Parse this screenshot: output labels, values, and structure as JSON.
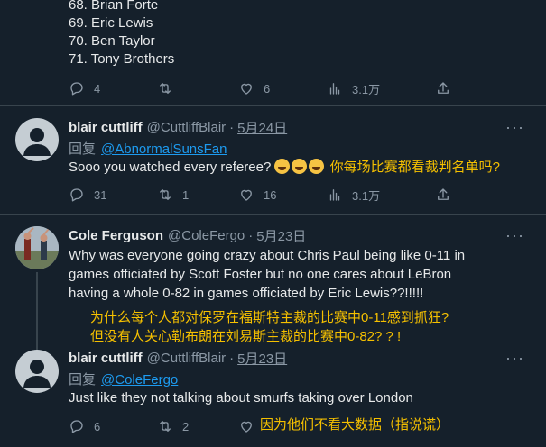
{
  "top_list": {
    "items": [
      "68. Brian Forte",
      "69. Eric Lewis",
      "70. Ben Taylor",
      "71. Tony Brothers"
    ],
    "actions": {
      "replies": "4",
      "retweets": "",
      "likes": "6",
      "views": "3.1万"
    }
  },
  "tweet1": {
    "name": "blair cuttliff",
    "handle": "@CuttliffBlair",
    "separator": "·",
    "date": "5月24日",
    "more": "···",
    "reply_label": "回复",
    "reply_to": "@AbnormalSunsFan",
    "text": "Sooo you watched every referee?",
    "translation": "你每场比赛都看裁判名单吗?",
    "actions": {
      "replies": "31",
      "retweets": "1",
      "likes": "16",
      "views": "3.1万"
    }
  },
  "tweet2": {
    "name": "Cole Ferguson",
    "handle": "@ColeFergo",
    "separator": "·",
    "date": "5月23日",
    "more": "···",
    "lines": [
      "Why was everyone going crazy about Chris Paul being like 0-11 in",
      "games officiated by Scott Foster but no one cares about LeBron",
      "having a whole 0-82 in games officiated by Eric Lewis??!!!!!"
    ],
    "translation_lines": [
      "为什么每个人都对保罗在福斯特主裁的比赛中0-11感到抓狂?",
      "但没有人关心勒布朗在刘易斯主裁的比赛中0-82? ? !"
    ]
  },
  "tweet3": {
    "name": "blair cuttliff",
    "handle": "@CuttliffBlair",
    "separator": "·",
    "date": "5月23日",
    "more": "···",
    "reply_label": "回复",
    "reply_to": "@ColeFergo",
    "text": "Just like they not talking about smurfs taking over London",
    "translation": "因为他们不看大数据（指说谎）",
    "actions": {
      "replies": "6",
      "retweets": "2"
    }
  },
  "colors": {
    "background": "#15202b",
    "muted": "#8b98a5",
    "link": "#1d9bf0",
    "annotation": "#f5c000"
  }
}
